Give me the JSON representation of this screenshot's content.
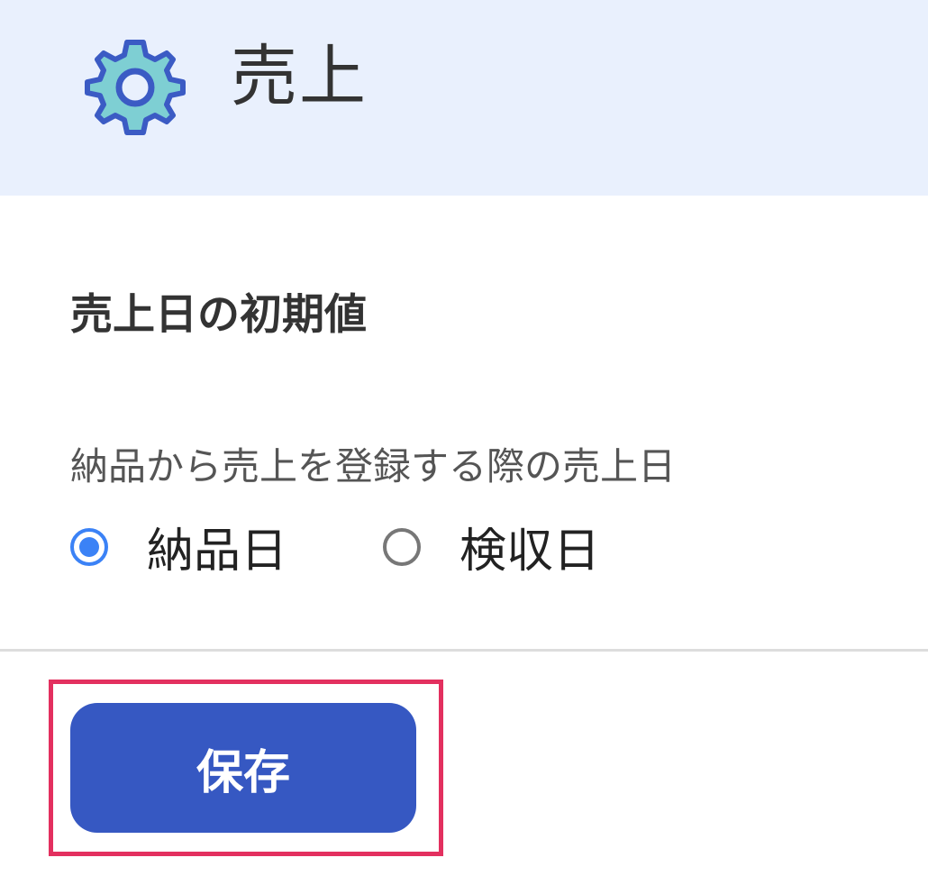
{
  "header": {
    "icon": "gear-icon",
    "title": "売上",
    "background_color": "#e9f0fd"
  },
  "section": {
    "title": "売上日の初期値"
  },
  "sales_date_field": {
    "label": "納品から売上を登録する際の売上日",
    "options": [
      {
        "label": "納品日",
        "selected": true
      },
      {
        "label": "検収日",
        "selected": false
      }
    ]
  },
  "actions": {
    "save_label": "保存",
    "accent_color": "#3658c2",
    "highlight_color": "#e3305f"
  }
}
